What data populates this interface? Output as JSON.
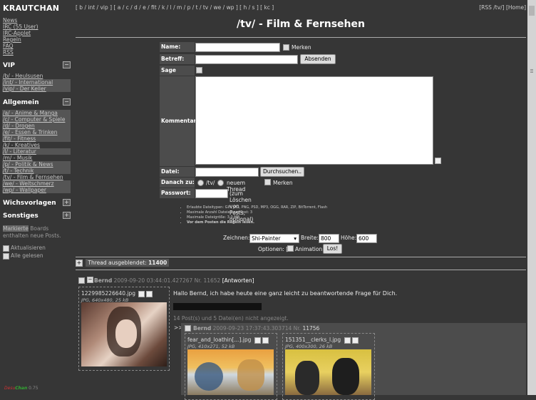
{
  "sidebar": {
    "brand": "KRAUTCHAN",
    "top_links": [
      "News",
      "IRC (55 User)",
      "IRC-Applet",
      "Regeln",
      "FAQ",
      "RSS"
    ],
    "vip": {
      "title": "VIP",
      "toggle": "−",
      "boards": [
        {
          "label": "/b/ - Heulsusen"
        },
        {
          "label": "/int/ - International"
        },
        {
          "label": "/vip/ - Der Keller"
        }
      ]
    },
    "allgemein": {
      "title": "Allgemein",
      "toggle": "−",
      "boards": [
        {
          "label": "/a/ - Anime & Manga"
        },
        {
          "label": "/c/ - Computer & Spiele"
        },
        {
          "label": "/d/ - Drogen"
        },
        {
          "label": "/e/ - Essen & Trinken"
        },
        {
          "label": "/fit/ - Fitness"
        },
        {
          "label": "/k/ - Kreatives"
        },
        {
          "label": "/l/ - Literatur"
        },
        {
          "label": "/m/ - Musik"
        },
        {
          "label": "/p/ - Politik & News"
        },
        {
          "label": "/t/ - Technik"
        },
        {
          "label": "/tv/ - Film & Fernsehen"
        },
        {
          "label": "/we/ - Weltschmerz"
        },
        {
          "label": "/wp/ - Wallpaper"
        }
      ]
    },
    "wichsvorlagen": {
      "title": "Wichsvorlagen",
      "toggle": "+"
    },
    "sonstiges": {
      "title": "Sonstiges",
      "toggle": "+"
    },
    "note_line1_link": "Markierte",
    "note_line1_rest": "Boards",
    "note_line2": "enthalten neue Posts.",
    "check_refresh": "Aktualisieren",
    "check_allread": "Alle gelesen",
    "footer_a": "Desu",
    "footer_b": "Chan",
    "footer_ver": "0.75"
  },
  "nav": {
    "boards_line": "[ b / int / vip ] [ a / c / d / e / fit / k / l / m / p / t / tv / we / wp ] [ h / s ] [ kc ]",
    "right": "[RSS /tv/] [Home]"
  },
  "page_title": "/tv/ - Film & Fernsehen",
  "form": {
    "name_label": "Name:",
    "merken_label": "Merken",
    "betreff_label": "Betreff:",
    "submit_button": "Absenden",
    "sage_label": "Sage",
    "kommentar_label": "Kommentar:",
    "datei_label": "Datei:",
    "browse_button": "Durchsuchen..",
    "danach_label": "Danach zu:",
    "danach_opt1": "/tv/",
    "danach_opt2": "neuem Thread",
    "danach_merken": "Merken",
    "passwort_label": "Passwort:",
    "passwort_hint": "(zum Löschen von Posts, optional)"
  },
  "rules": [
    "Erlaubte Dateitypen: GIF, JPG, PNG, PSD, MP3, OGG, RAR, ZIP, BitTorrent, Flash",
    "Maximale Anzahl Dateien pro Post: 3",
    "Maximale Dateigröße: 3.0 MB",
    "Vor dem Posten die Regeln lesen."
  ],
  "drawing": {
    "label": "Zeichnen:",
    "tool": "Shi-Painter",
    "width_label": "Breite:",
    "width_value": "800",
    "height_label": "Höhe:",
    "height_value": "600",
    "options_label": "Optionen: [",
    "animation_label": "Animation]",
    "go_button": "Los!"
  },
  "hidden_thread": {
    "label": "Thread ausgeblendet:",
    "number": "11400"
  },
  "thread": {
    "name": "Bernd",
    "datetime": "2009-09-20 03:44:01.427267 Nr.",
    "number": "11652",
    "reply_link": "[Antworten]",
    "file_name": "1229985226640.jpg",
    "file_meta": "JPG, 640x480, 25 kB",
    "text": "Hallo Bernd, ich habe heute eine ganz leicht zu beantwortende Frage für Dich.",
    "omitted": "14 Post(s) und 5 Datei(en) nicht angezeigt."
  },
  "reply": {
    "arrow": ">>",
    "name": "Bernd",
    "datetime": "2009-09-23 17:37:43.303714 Nr.",
    "number": "11756",
    "file1_name": "fear_and_loathin[...].jpg",
    "file1_meta": "JPG, 410x271, 52 kB",
    "file2_name": "151351__clerks_l.jpg",
    "file2_meta": "JPG, 400x300, 26 kB"
  }
}
